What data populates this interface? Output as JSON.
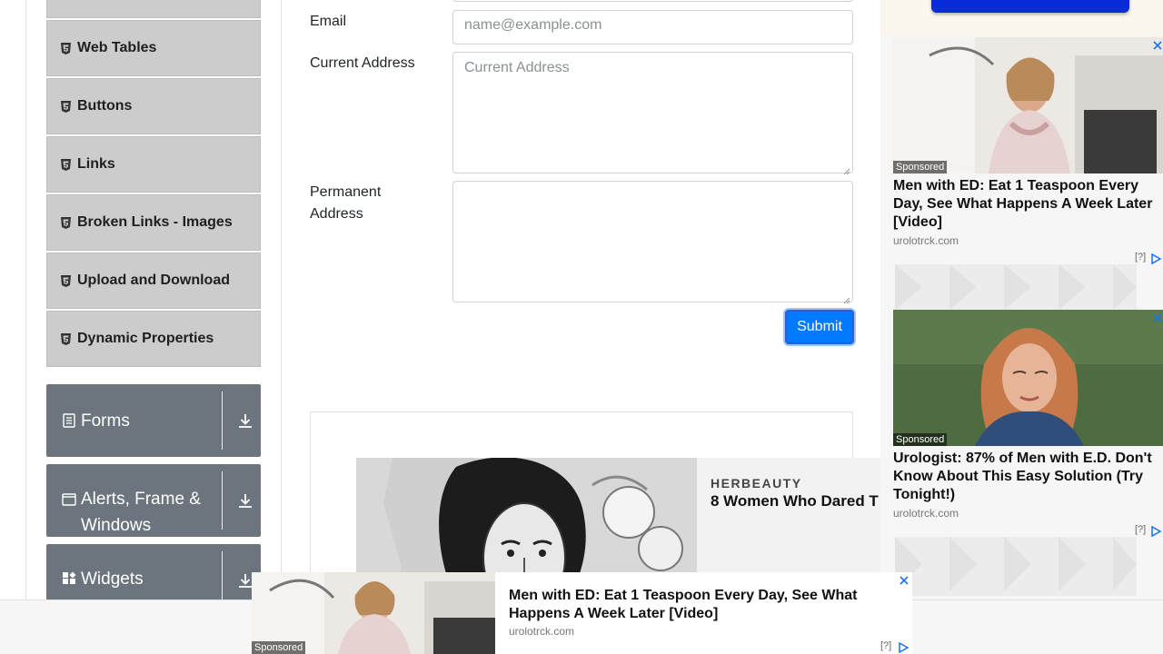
{
  "sidebar": {
    "items": [
      {
        "label": "",
        "icon": "html5-icon"
      },
      {
        "label": "Web Tables",
        "icon": "html5-icon"
      },
      {
        "label": "Buttons",
        "icon": "html5-icon"
      },
      {
        "label": "Links",
        "icon": "html5-icon"
      },
      {
        "label": "Broken Links - Images",
        "icon": "html5-icon"
      },
      {
        "label": "Upload and Download",
        "icon": "html5-icon"
      },
      {
        "label": "Dynamic Properties",
        "icon": "html5-icon"
      }
    ],
    "groups": [
      {
        "label": "Forms",
        "icon": "form-icon"
      },
      {
        "label": "Alerts, Frame & Windows",
        "icon": "window-icon"
      },
      {
        "label": "Widgets",
        "icon": "widgets-icon"
      }
    ]
  },
  "form": {
    "email_label": "Email",
    "email_placeholder": "name@example.com",
    "current_address_label": "Current Address",
    "current_address_placeholder": "Current Address",
    "permanent_address_label": "Permanent Address",
    "submit_label": "Submit"
  },
  "herbeauty_ad": {
    "brand": "HERBEAUTY",
    "title": "8 Women Who Dared T"
  },
  "right_ads": [
    {
      "sponsored": "Sponsored",
      "title": "Men with ED: Eat 1 Teaspoon Every Day, See What Happens A Week Later [Video]",
      "domain": "urolotrck.com",
      "adchoice": "[?]"
    },
    {
      "sponsored": "Sponsored",
      "title": "Urologist: 87% of Men with E.D. Don't Know About This Easy Solution (Try Tonight!)",
      "domain": "urolotrck.com",
      "adchoice": "[?]"
    }
  ],
  "bottom_ad": {
    "sponsored": "Sponsored",
    "title": "Men with ED: Eat 1 Teaspoon Every Day, See What Happens A Week Later [Video]",
    "domain": "urolotrck.com",
    "adchoice": "[?]"
  },
  "colors": {
    "primary": "#007bff",
    "menu_item_bg": "#cccccc",
    "group_bg": "#6c757d",
    "ad_blue_button": "#0a2bd8"
  }
}
